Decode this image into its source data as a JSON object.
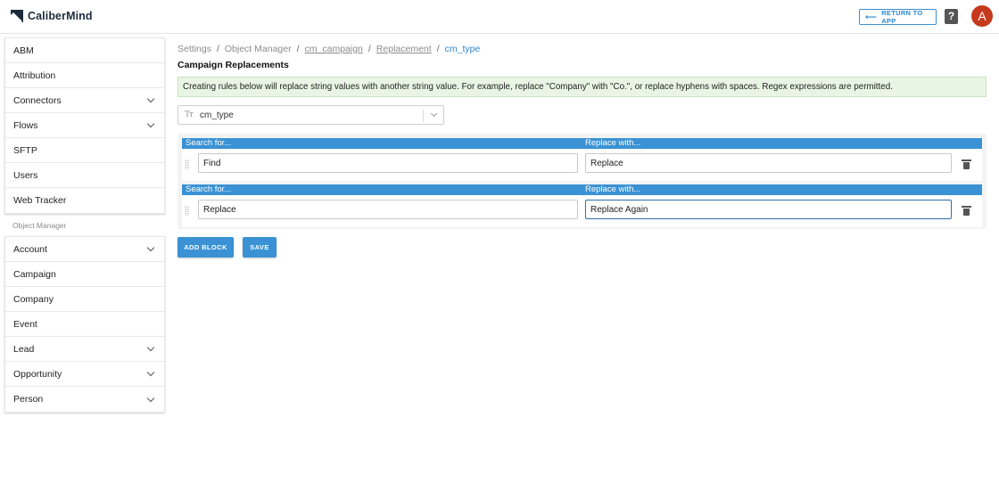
{
  "app": {
    "name": "CaliberMind",
    "return_label": "RETURN TO APP",
    "help_glyph": "?",
    "avatar_initial": "A",
    "accent_color": "#2f88cc",
    "avatar_color": "#c5391c"
  },
  "sidebar": {
    "items": [
      {
        "label": "ABM",
        "chevron": false
      },
      {
        "label": "Attribution",
        "chevron": false
      },
      {
        "label": "Connectors",
        "chevron": true
      },
      {
        "label": "Flows",
        "chevron": true
      },
      {
        "label": "SFTP",
        "chevron": false
      },
      {
        "label": "Users",
        "chevron": false
      },
      {
        "label": "Web Tracker",
        "chevron": false
      }
    ],
    "section_label": "Object Manager",
    "object_items": [
      {
        "label": "Account",
        "chevron": true
      },
      {
        "label": "Campaign",
        "chevron": false
      },
      {
        "label": "Company",
        "chevron": false
      },
      {
        "label": "Event",
        "chevron": false
      },
      {
        "label": "Lead",
        "chevron": true
      },
      {
        "label": "Opportunity",
        "chevron": true
      },
      {
        "label": "Person",
        "chevron": true
      }
    ]
  },
  "breadcrumb": {
    "settings": "Settings",
    "object_manager": "Object Manager",
    "cm_campaign": "cm_campaign",
    "replacement": "Replacement",
    "current": "cm_type",
    "separator": "/"
  },
  "page": {
    "title": "Campaign Replacements",
    "info": "Creating rules below will replace string values with another string value. For example, replace \"Company\" with \"Co.\", or replace hyphens with spaces. Regex expressions are permitted.",
    "select_icon_text": "Tт",
    "select_value": "cm_type"
  },
  "blocks": [
    {
      "search_header": "Search for...",
      "replace_header": "Replace with...",
      "search_value": "Find",
      "replace_value": "Replace"
    },
    {
      "search_header": "Search for...",
      "replace_header": "Replace with...",
      "search_value": "Replace",
      "replace_value": "Replace Again"
    }
  ],
  "actions": {
    "add_block": "ADD BLOCK",
    "save": "SAVE"
  }
}
